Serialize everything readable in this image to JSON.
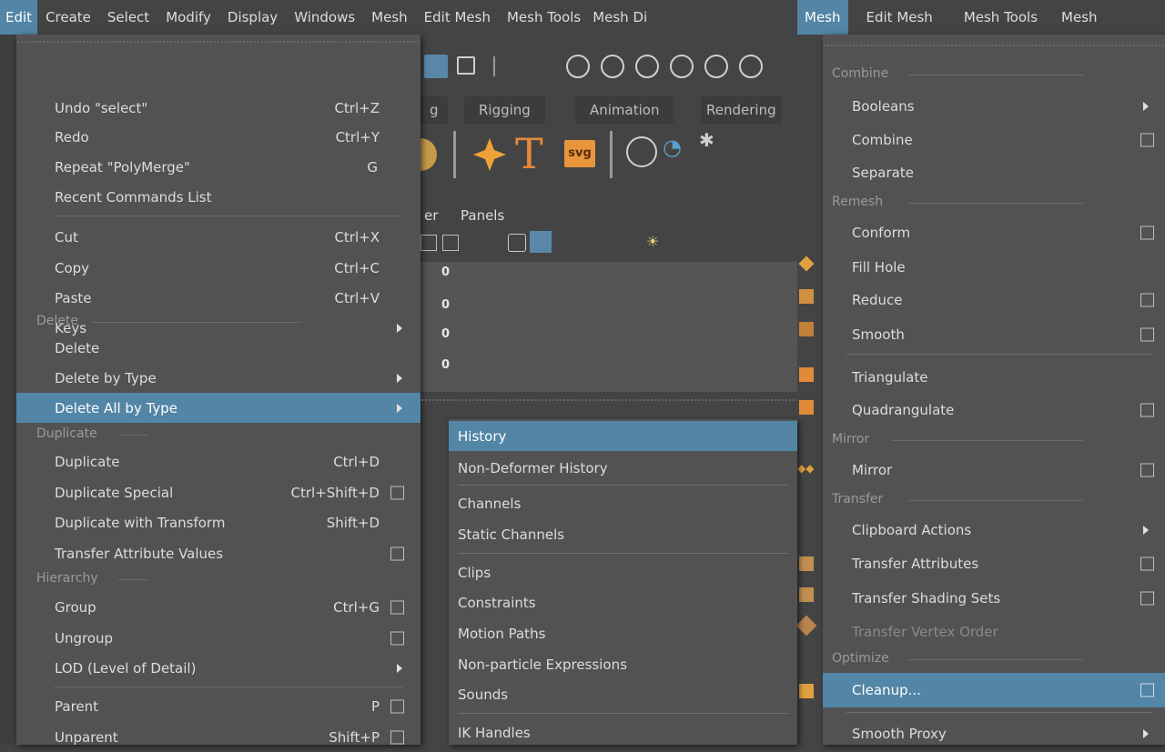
{
  "menubar_left": [
    "Edit",
    "Create",
    "Select",
    "Modify",
    "Display",
    "Windows",
    "Mesh",
    "Edit Mesh",
    "Mesh Tools",
    "Mesh Di"
  ],
  "menubar_right": [
    "Mesh",
    "Edit Mesh",
    "Mesh Tools",
    "Mesh"
  ],
  "shelf_tabs": [
    "g",
    "Rigging",
    "Animation",
    "Rendering"
  ],
  "panel_menu": [
    "er",
    "Panels"
  ],
  "viewport_values": [
    "0",
    "0",
    "0",
    "0"
  ],
  "edit_menu": {
    "items": [
      {
        "label": "Undo \"select\"",
        "shortcut": "Ctrl+Z"
      },
      {
        "label": "Redo",
        "shortcut": "Ctrl+Y"
      },
      {
        "label": "Repeat \"PolyMerge\"",
        "shortcut": "G"
      },
      {
        "label": "Recent Commands List"
      },
      {
        "label": "Cut",
        "shortcut": "Ctrl+X"
      },
      {
        "label": "Copy",
        "shortcut": "Ctrl+C"
      },
      {
        "label": "Paste",
        "shortcut": "Ctrl+V"
      },
      {
        "label": "Keys"
      },
      {
        "label": "Delete"
      },
      {
        "label": "Delete by Type"
      },
      {
        "label": "Delete All by Type"
      },
      {
        "label": "Duplicate",
        "shortcut": "Ctrl+D"
      },
      {
        "label": "Duplicate Special",
        "shortcut": "Ctrl+Shift+D"
      },
      {
        "label": "Duplicate with Transform",
        "shortcut": "Shift+D"
      },
      {
        "label": "Transfer Attribute Values"
      },
      {
        "label": "Group",
        "shortcut": "Ctrl+G"
      },
      {
        "label": "Ungroup"
      },
      {
        "label": "LOD (Level of Detail)"
      },
      {
        "label": "Parent",
        "shortcut": "P"
      },
      {
        "label": "Unparent",
        "shortcut": "Shift+P"
      }
    ],
    "sections": [
      "Delete",
      "Duplicate",
      "Hierarchy"
    ]
  },
  "submenu": {
    "items": [
      "History",
      "Non-Deformer History",
      "Channels",
      "Static Channels",
      "Clips",
      "Constraints",
      "Motion Paths",
      "Non-particle Expressions",
      "Sounds",
      "IK Handles"
    ]
  },
  "mesh_menu": {
    "sections": [
      "Combine",
      "Remesh",
      "Mirror",
      "Transfer",
      "Optimize"
    ],
    "items": [
      "Booleans",
      "Combine",
      "Separate",
      "Conform",
      "Fill Hole",
      "Reduce",
      "Smooth",
      "Triangulate",
      "Quadrangulate",
      "Mirror",
      "Clipboard Actions",
      "Transfer Attributes",
      "Transfer Shading Sets",
      "Transfer Vertex Order",
      "Cleanup...",
      "Smooth Proxy"
    ]
  },
  "colors": {
    "highlight": "#5285a6",
    "menu_bg": "#525252",
    "app_bg": "#444444"
  }
}
